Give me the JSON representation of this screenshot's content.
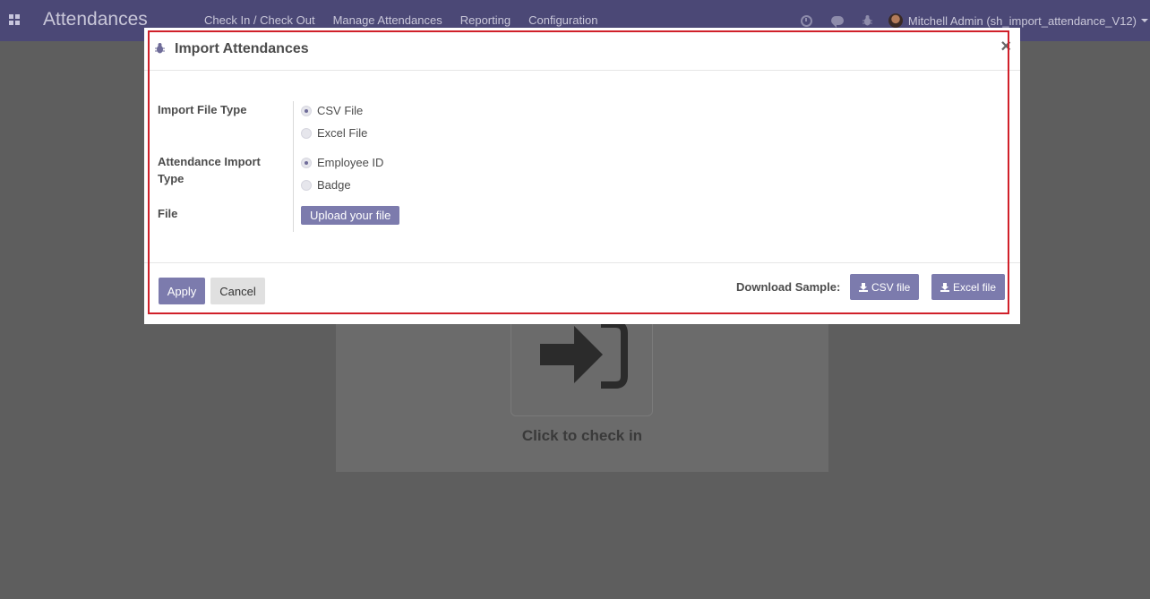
{
  "navbar": {
    "app_title": "Attendances",
    "menu": [
      "Check In / Check Out",
      "Manage Attendances",
      "Reporting",
      "Configuration"
    ],
    "user": "Mitchell Admin (sh_import_attendance_V12)"
  },
  "kiosk": {
    "label": "Click to check in"
  },
  "modal": {
    "title": "Import Attendances",
    "close": "×",
    "fields": {
      "file_type_label": "Import File Type",
      "file_type_options": [
        "CSV File",
        "Excel File"
      ],
      "file_type_selected": "CSV File",
      "import_type_label": "Attendance Import Type",
      "import_type_options": [
        "Employee ID",
        "Badge"
      ],
      "import_type_selected": "Employee ID",
      "file_label": "File",
      "upload_label": "Upload your file"
    },
    "footer": {
      "apply": "Apply",
      "cancel": "Cancel",
      "download_sample": "Download Sample:",
      "csv_button": "CSV file",
      "excel_button": "Excel file"
    }
  },
  "colors": {
    "navbar": "#4b4876",
    "primary": "#7c7bad",
    "highlight": "#d0202a"
  }
}
